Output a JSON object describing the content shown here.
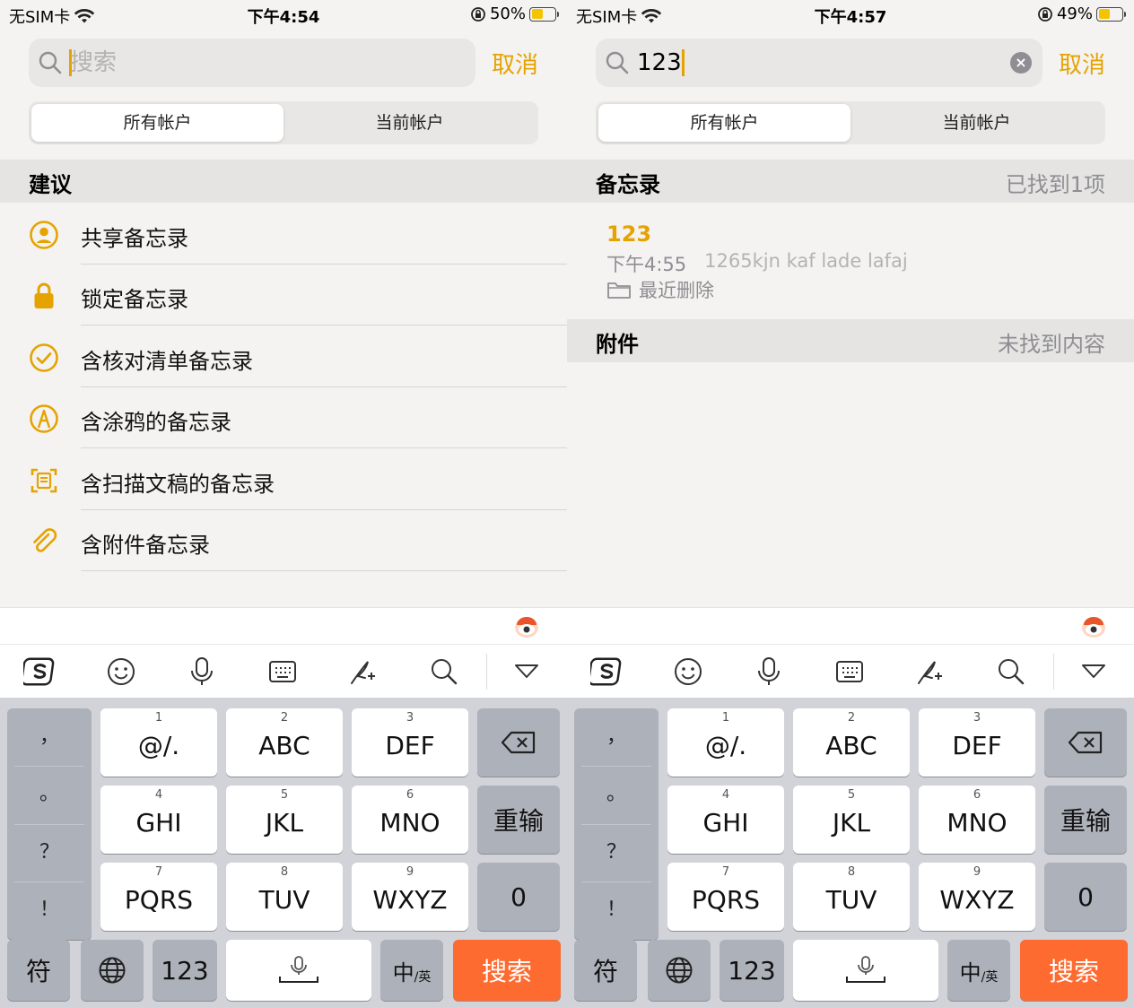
{
  "screens": [
    {
      "status": {
        "carrier": "无SIM卡",
        "time": "下午4:54",
        "battery": "50%",
        "battery_level": 0.5
      },
      "search": {
        "placeholder": "搜索",
        "value": "",
        "cancel": "取消"
      },
      "segments": [
        "所有帐户",
        "当前帐户"
      ],
      "section": {
        "title": "建议"
      },
      "suggestions": [
        {
          "label": "共享备忘录",
          "icon": "shared-person-icon"
        },
        {
          "label": "锁定备忘录",
          "icon": "lock-icon"
        },
        {
          "label": "含核对清单备忘录",
          "icon": "checkmark-circle-icon"
        },
        {
          "label": "含涂鸦的备忘录",
          "icon": "drawing-pen-icon"
        },
        {
          "label": "含扫描文稿的备忘录",
          "icon": "scan-document-icon"
        },
        {
          "label": "含附件备忘录",
          "icon": "paperclip-icon"
        }
      ]
    },
    {
      "status": {
        "carrier": "无SIM卡",
        "time": "下午4:57",
        "battery": "49%",
        "battery_level": 0.49
      },
      "search": {
        "placeholder": "",
        "value": "123",
        "cancel": "取消"
      },
      "segments": [
        "所有帐户",
        "当前帐户"
      ],
      "notes_section": {
        "title": "备忘录",
        "count": "已找到1项"
      },
      "result": {
        "title": "123",
        "time": "下午4:55",
        "preview": "1265kjn kaf lade lafaj",
        "folder": "最近删除"
      },
      "attachments_section": {
        "title": "附件",
        "status": "未找到内容"
      }
    }
  ],
  "keyboard": {
    "punctuation": [
      "，",
      "。",
      "？",
      "！"
    ],
    "keys": [
      {
        "num": "1",
        "label": "@/."
      },
      {
        "num": "2",
        "label": "ABC"
      },
      {
        "num": "3",
        "label": "DEF"
      },
      {
        "num": "4",
        "label": "GHI"
      },
      {
        "num": "5",
        "label": "JKL"
      },
      {
        "num": "6",
        "label": "MNO"
      },
      {
        "num": "7",
        "label": "PQRS"
      },
      {
        "num": "8",
        "label": "TUV"
      },
      {
        "num": "9",
        "label": "WXYZ"
      }
    ],
    "retype": "重输",
    "zero": "0",
    "symbols": "符",
    "numbers": "123",
    "lang_main": "中",
    "lang_sub": "/英",
    "search": "搜索",
    "toolbar_icons": [
      "sogou-logo-icon",
      "emoji-icon",
      "microphone-icon",
      "keyboard-icon",
      "handwriting-icon",
      "search-icon",
      "collapse-keyboard-icon"
    ]
  },
  "colors": {
    "accent": "#e5a300",
    "search_key": "#fd6b30",
    "keyboard_bg": "#d1d3d9",
    "panel_bg": "#f4f3f1"
  }
}
